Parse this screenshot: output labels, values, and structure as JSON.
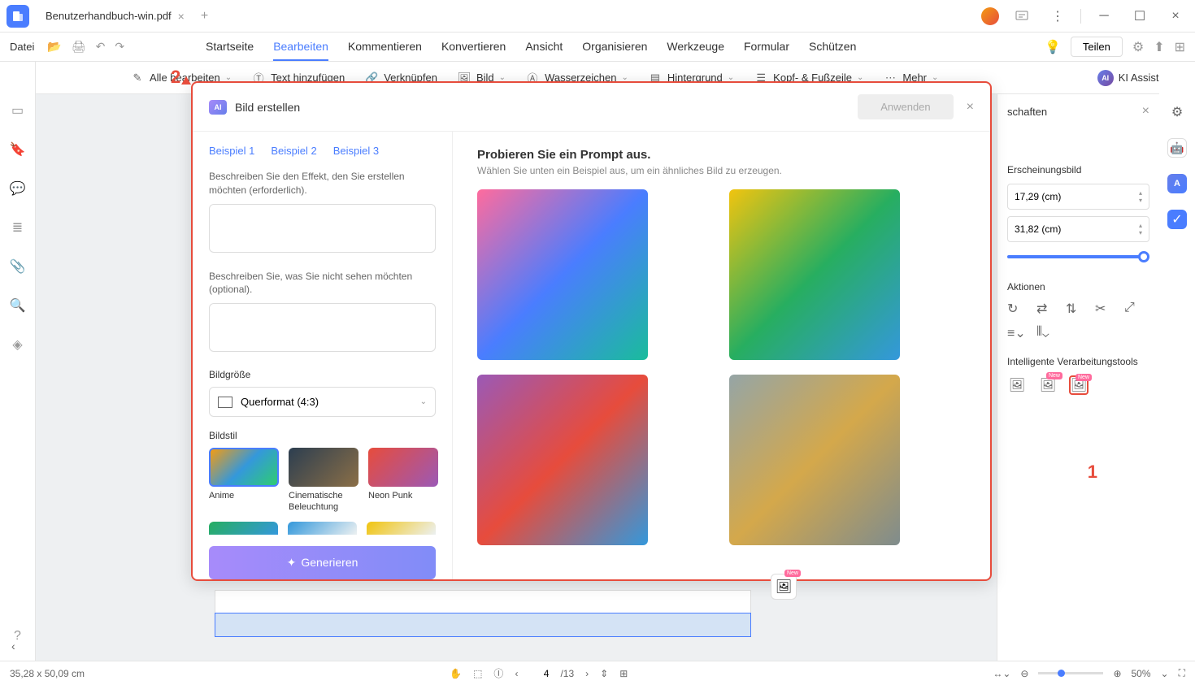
{
  "titlebar": {
    "tab_name": "Benutzerhandbuch-win.pdf"
  },
  "menubar": {
    "file": "Datei",
    "tabs": [
      {
        "label": "Startseite"
      },
      {
        "label": "Bearbeiten"
      },
      {
        "label": "Kommentieren"
      },
      {
        "label": "Konvertieren"
      },
      {
        "label": "Ansicht"
      },
      {
        "label": "Organisieren"
      },
      {
        "label": "Werkzeuge"
      },
      {
        "label": "Formular"
      },
      {
        "label": "Schützen"
      }
    ],
    "share": "Teilen"
  },
  "toolbar": {
    "edit_all": "Alle bearbeiten",
    "add_text": "Text hinzufügen",
    "link": "Verknüpfen",
    "image": "Bild",
    "watermark": "Wasserzeichen",
    "background": "Hintergrund",
    "header_footer": "Kopf- & Fußzeile",
    "more": "Mehr",
    "ai_assistant": "KI Assistent"
  },
  "right_panel": {
    "title": "schaften",
    "appearance": "Erscheinungsbild",
    "width": "17,29 (cm)",
    "height": "31,82 (cm)",
    "actions": "Aktionen",
    "smart_tools": "Intelligente Verarbeitungstools"
  },
  "dialog": {
    "ai_badge": "AI",
    "title": "Bild erstellen",
    "apply": "Anwenden",
    "examples": [
      "Beispiel 1",
      "Beispiel 2",
      "Beispiel 3"
    ],
    "desc_label": "Beschreiben Sie den Effekt, den Sie erstellen möchten (erforderlich).",
    "neg_label": "Beschreiben Sie, was Sie nicht sehen möchten (optional).",
    "size_label": "Bildgröße",
    "size_value": "Querformat (4:3)",
    "style_label": "Bildstil",
    "styles": [
      {
        "name": "Anime"
      },
      {
        "name": "Cinematische Beleuchtung"
      },
      {
        "name": "Neon Punk"
      }
    ],
    "generate": "Generieren",
    "prompt_title": "Probieren Sie ein Prompt aus.",
    "prompt_sub": "Wählen Sie unten ein Beispiel aus, um ein ähnliches Bild zu erzeugen."
  },
  "statusbar": {
    "dims": "35,28 x 50,09 cm",
    "page_current": "4",
    "page_total": "/13",
    "zoom": "50%"
  },
  "markers": {
    "m1": "1",
    "m2": "2"
  }
}
